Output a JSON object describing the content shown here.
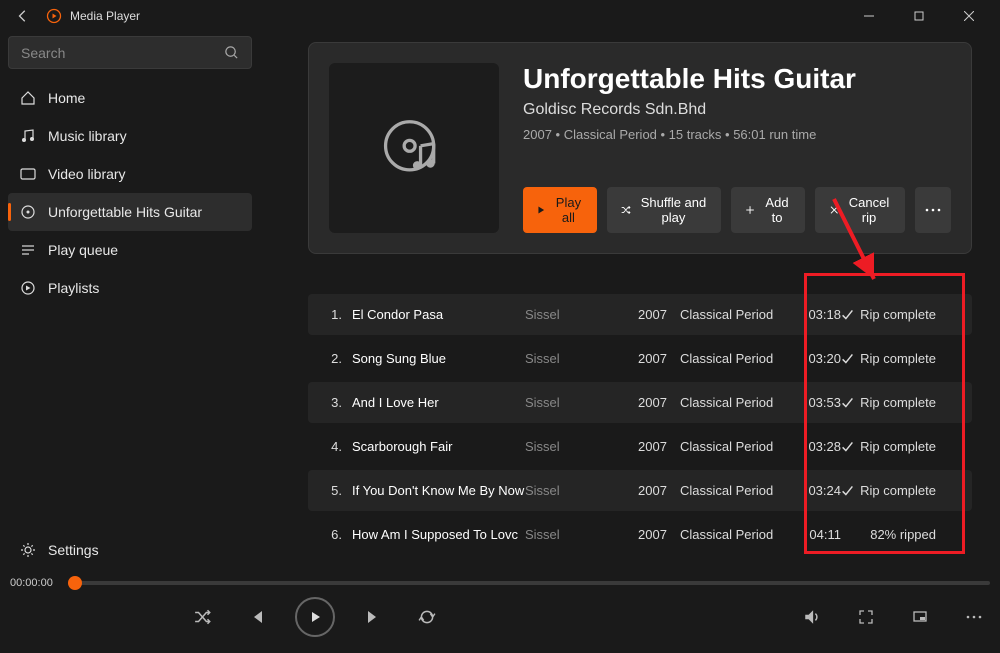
{
  "app": {
    "title": "Media Player"
  },
  "search": {
    "placeholder": "Search"
  },
  "nav": {
    "home": "Home",
    "music": "Music library",
    "video": "Video library",
    "current_album": "Unforgettable Hits Guitar",
    "queue": "Play queue",
    "playlists": "Playlists",
    "settings": "Settings"
  },
  "album": {
    "title": "Unforgettable Hits Guitar",
    "artist": "Goldisc Records Sdn.Bhd",
    "meta": "2007 • Classical Period • 15 tracks • 56:01 run time"
  },
  "buttons": {
    "play_all": "Play all",
    "shuffle": "Shuffle and play",
    "add_to": "Add to",
    "cancel_rip": "Cancel rip"
  },
  "tracks": [
    {
      "num": "1.",
      "title": "El Condor Pasa",
      "artist": "Sissel",
      "year": "2007",
      "genre": "Classical Period",
      "duration": "03:18",
      "status": "Rip complete",
      "complete": true
    },
    {
      "num": "2.",
      "title": "Song Sung Blue",
      "artist": "Sissel",
      "year": "2007",
      "genre": "Classical Period",
      "duration": "03:20",
      "status": "Rip complete",
      "complete": true
    },
    {
      "num": "3.",
      "title": "And I Love Her",
      "artist": "Sissel",
      "year": "2007",
      "genre": "Classical Period",
      "duration": "03:53",
      "status": "Rip complete",
      "complete": true
    },
    {
      "num": "4.",
      "title": "Scarborough Fair",
      "artist": "Sissel",
      "year": "2007",
      "genre": "Classical Period",
      "duration": "03:28",
      "status": "Rip complete",
      "complete": true
    },
    {
      "num": "5.",
      "title": "If You Don't Know Me By Now",
      "artist": "Sissel",
      "year": "2007",
      "genre": "Classical Period",
      "duration": "03:24",
      "status": "Rip complete",
      "complete": true
    },
    {
      "num": "6.",
      "title": "How Am I Supposed To Lovc",
      "artist": "Sissel",
      "year": "2007",
      "genre": "Classical Period",
      "duration": "04:11",
      "status": "82% ripped",
      "complete": false
    }
  ],
  "player": {
    "time": "00:00:00"
  }
}
